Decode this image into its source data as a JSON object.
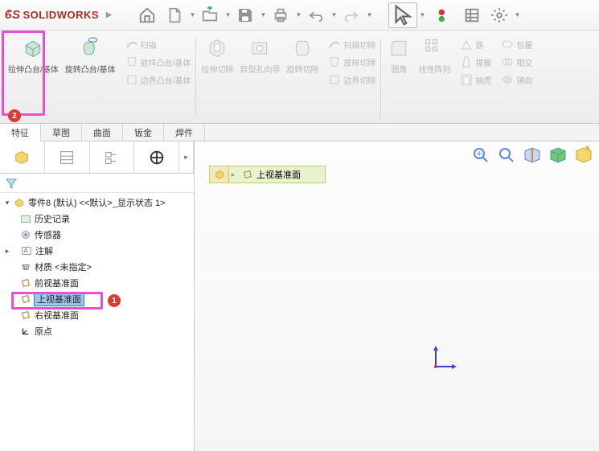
{
  "app": {
    "name": "SOLIDWORKS"
  },
  "ribbon": {
    "extrude": "拉伸凸台/基体",
    "revolve": "旋转凸台/基体",
    "sweep": "扫描",
    "loft": "放样凸台/基体",
    "boundary": "边界凸台/基体",
    "extrude_cut": "拉伸切除",
    "hole": "异型孔向导",
    "rev_cut": "旋转切除",
    "sweep_cut": "扫描切除",
    "loft_cut": "放样切除",
    "boundary_cut": "边界切除",
    "fillet": "圆角",
    "pattern": "线性阵列",
    "rib": "筋",
    "draft": "拔模",
    "shell": "抽壳",
    "wrap": "包覆",
    "intersect": "相交",
    "mirror": "镜向"
  },
  "tabs": [
    "特征",
    "草图",
    "曲面",
    "钣金",
    "焊件"
  ],
  "tree": {
    "root": "零件8 (默认) <<默认>_显示状态 1>",
    "items": [
      {
        "label": "历史记录",
        "icon": "history-icon"
      },
      {
        "label": "传感器",
        "icon": "sensor-icon"
      },
      {
        "label": "注解",
        "icon": "annotation-icon",
        "expandable": true
      },
      {
        "label": "材质 <未指定>",
        "icon": "material-icon"
      },
      {
        "label": "前视基准面",
        "icon": "plane-icon"
      },
      {
        "label": "上视基准面",
        "icon": "plane-icon",
        "selected": true
      },
      {
        "label": "右视基准面",
        "icon": "plane-icon"
      },
      {
        "label": "原点",
        "icon": "origin-icon"
      }
    ]
  },
  "breadcrumb": {
    "label": "上视基准面"
  },
  "annotations": {
    "badge1": "1",
    "badge2": "2"
  }
}
